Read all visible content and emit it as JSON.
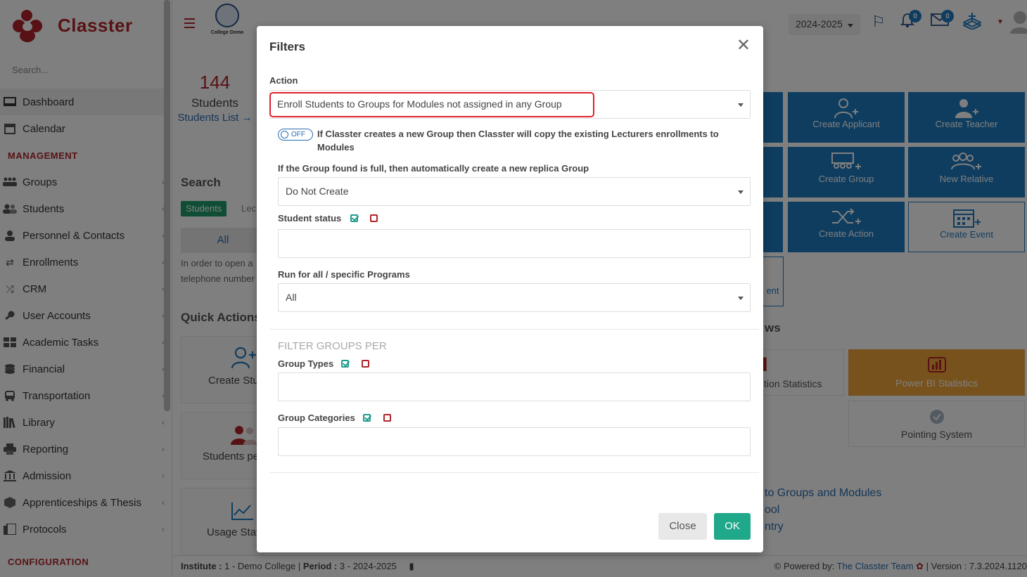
{
  "app": {
    "brand": "Classter",
    "college_caption": "College Demo",
    "year": "2024-2025",
    "notifications_count": "0",
    "messages_count": "0"
  },
  "colors": {
    "brand": "#b0252a",
    "primary": "#1e7bc0",
    "success": "#1fa88a",
    "danger": "#e0202a"
  },
  "sidebar": {
    "search_placeholder": "Search...",
    "items": [
      {
        "label": "Dashboard",
        "icon": "monitor-icon"
      },
      {
        "label": "Calendar",
        "icon": "calendar-icon"
      }
    ],
    "management_label": "MANAGEMENT",
    "management_items": [
      {
        "label": "Groups",
        "icon": "groups-icon"
      },
      {
        "label": "Students",
        "icon": "students-icon"
      },
      {
        "label": "Personnel & Contacts",
        "icon": "person-icon"
      },
      {
        "label": "Enrollments",
        "icon": "arrows-icon"
      },
      {
        "label": "CRM",
        "icon": "shuffle-icon"
      },
      {
        "label": "User Accounts",
        "icon": "key-icon"
      },
      {
        "label": "Academic Tasks",
        "icon": "grid-icon"
      },
      {
        "label": "Financial",
        "icon": "coins-icon"
      },
      {
        "label": "Transportation",
        "icon": "bus-icon"
      },
      {
        "label": "Library",
        "icon": "books-icon"
      },
      {
        "label": "Reporting",
        "icon": "printer-icon"
      },
      {
        "label": "Admission",
        "icon": "bank-icon"
      },
      {
        "label": "Apprenticeships & Thesis",
        "icon": "box-icon"
      },
      {
        "label": "Protocols",
        "icon": "protocol-icon"
      }
    ],
    "configuration_label": "CONFIGURATION"
  },
  "main": {
    "stat_number": "144",
    "stat_label": "Students",
    "stat_link": "Students List →",
    "search_heading": "Search",
    "search_tab_students": "Students",
    "search_tab_lecturers": "Lec",
    "all_button": "All",
    "info_text": "In order to open a telephone number",
    "quick_actions_heading": "Quick Actions",
    "quick_cards": [
      "Create Stu",
      "Students pe",
      "Usage Stat"
    ],
    "tiles": [
      "Create Applicant",
      "Create Teacher",
      "Create Group",
      "New Relative",
      "Create Action",
      "Create Event"
    ],
    "tile_edge_text": "ent",
    "reports_heading": "ws",
    "report_cards": [
      "tion Statistics",
      "Power BI Statistics",
      "Pointing System"
    ],
    "links": [
      "to Groups and Modules",
      "ool",
      "ntry"
    ]
  },
  "footer": {
    "institute_label": "Institute :",
    "institute_value": "1 - Demo College",
    "period_label": "Period :",
    "period_value": "3 - 2024-2025",
    "powered_by": "Powered by:",
    "team": "The Classter Team",
    "version": "| Version : 7.3.2024.1120"
  },
  "modal": {
    "title": "Filters",
    "action_label": "Action",
    "action_value": "Enroll Students to Groups for Modules not assigned in any Group",
    "toggle_state": "OFF",
    "toggle_text": "If Classter creates a new Group then Classter will copy the existing Lecturers enrollments to Modules",
    "replica_label": "If the Group found is full, then automatically create a new replica Group",
    "replica_value": "Do Not Create",
    "student_status_label": "Student status",
    "programs_label": "Run for all / specific Programs",
    "programs_value": "All",
    "filter_heading": "FILTER GROUPS PER",
    "group_types_label": "Group Types",
    "group_categories_label": "Group Categories",
    "close_button": "Close",
    "ok_button": "OK"
  }
}
